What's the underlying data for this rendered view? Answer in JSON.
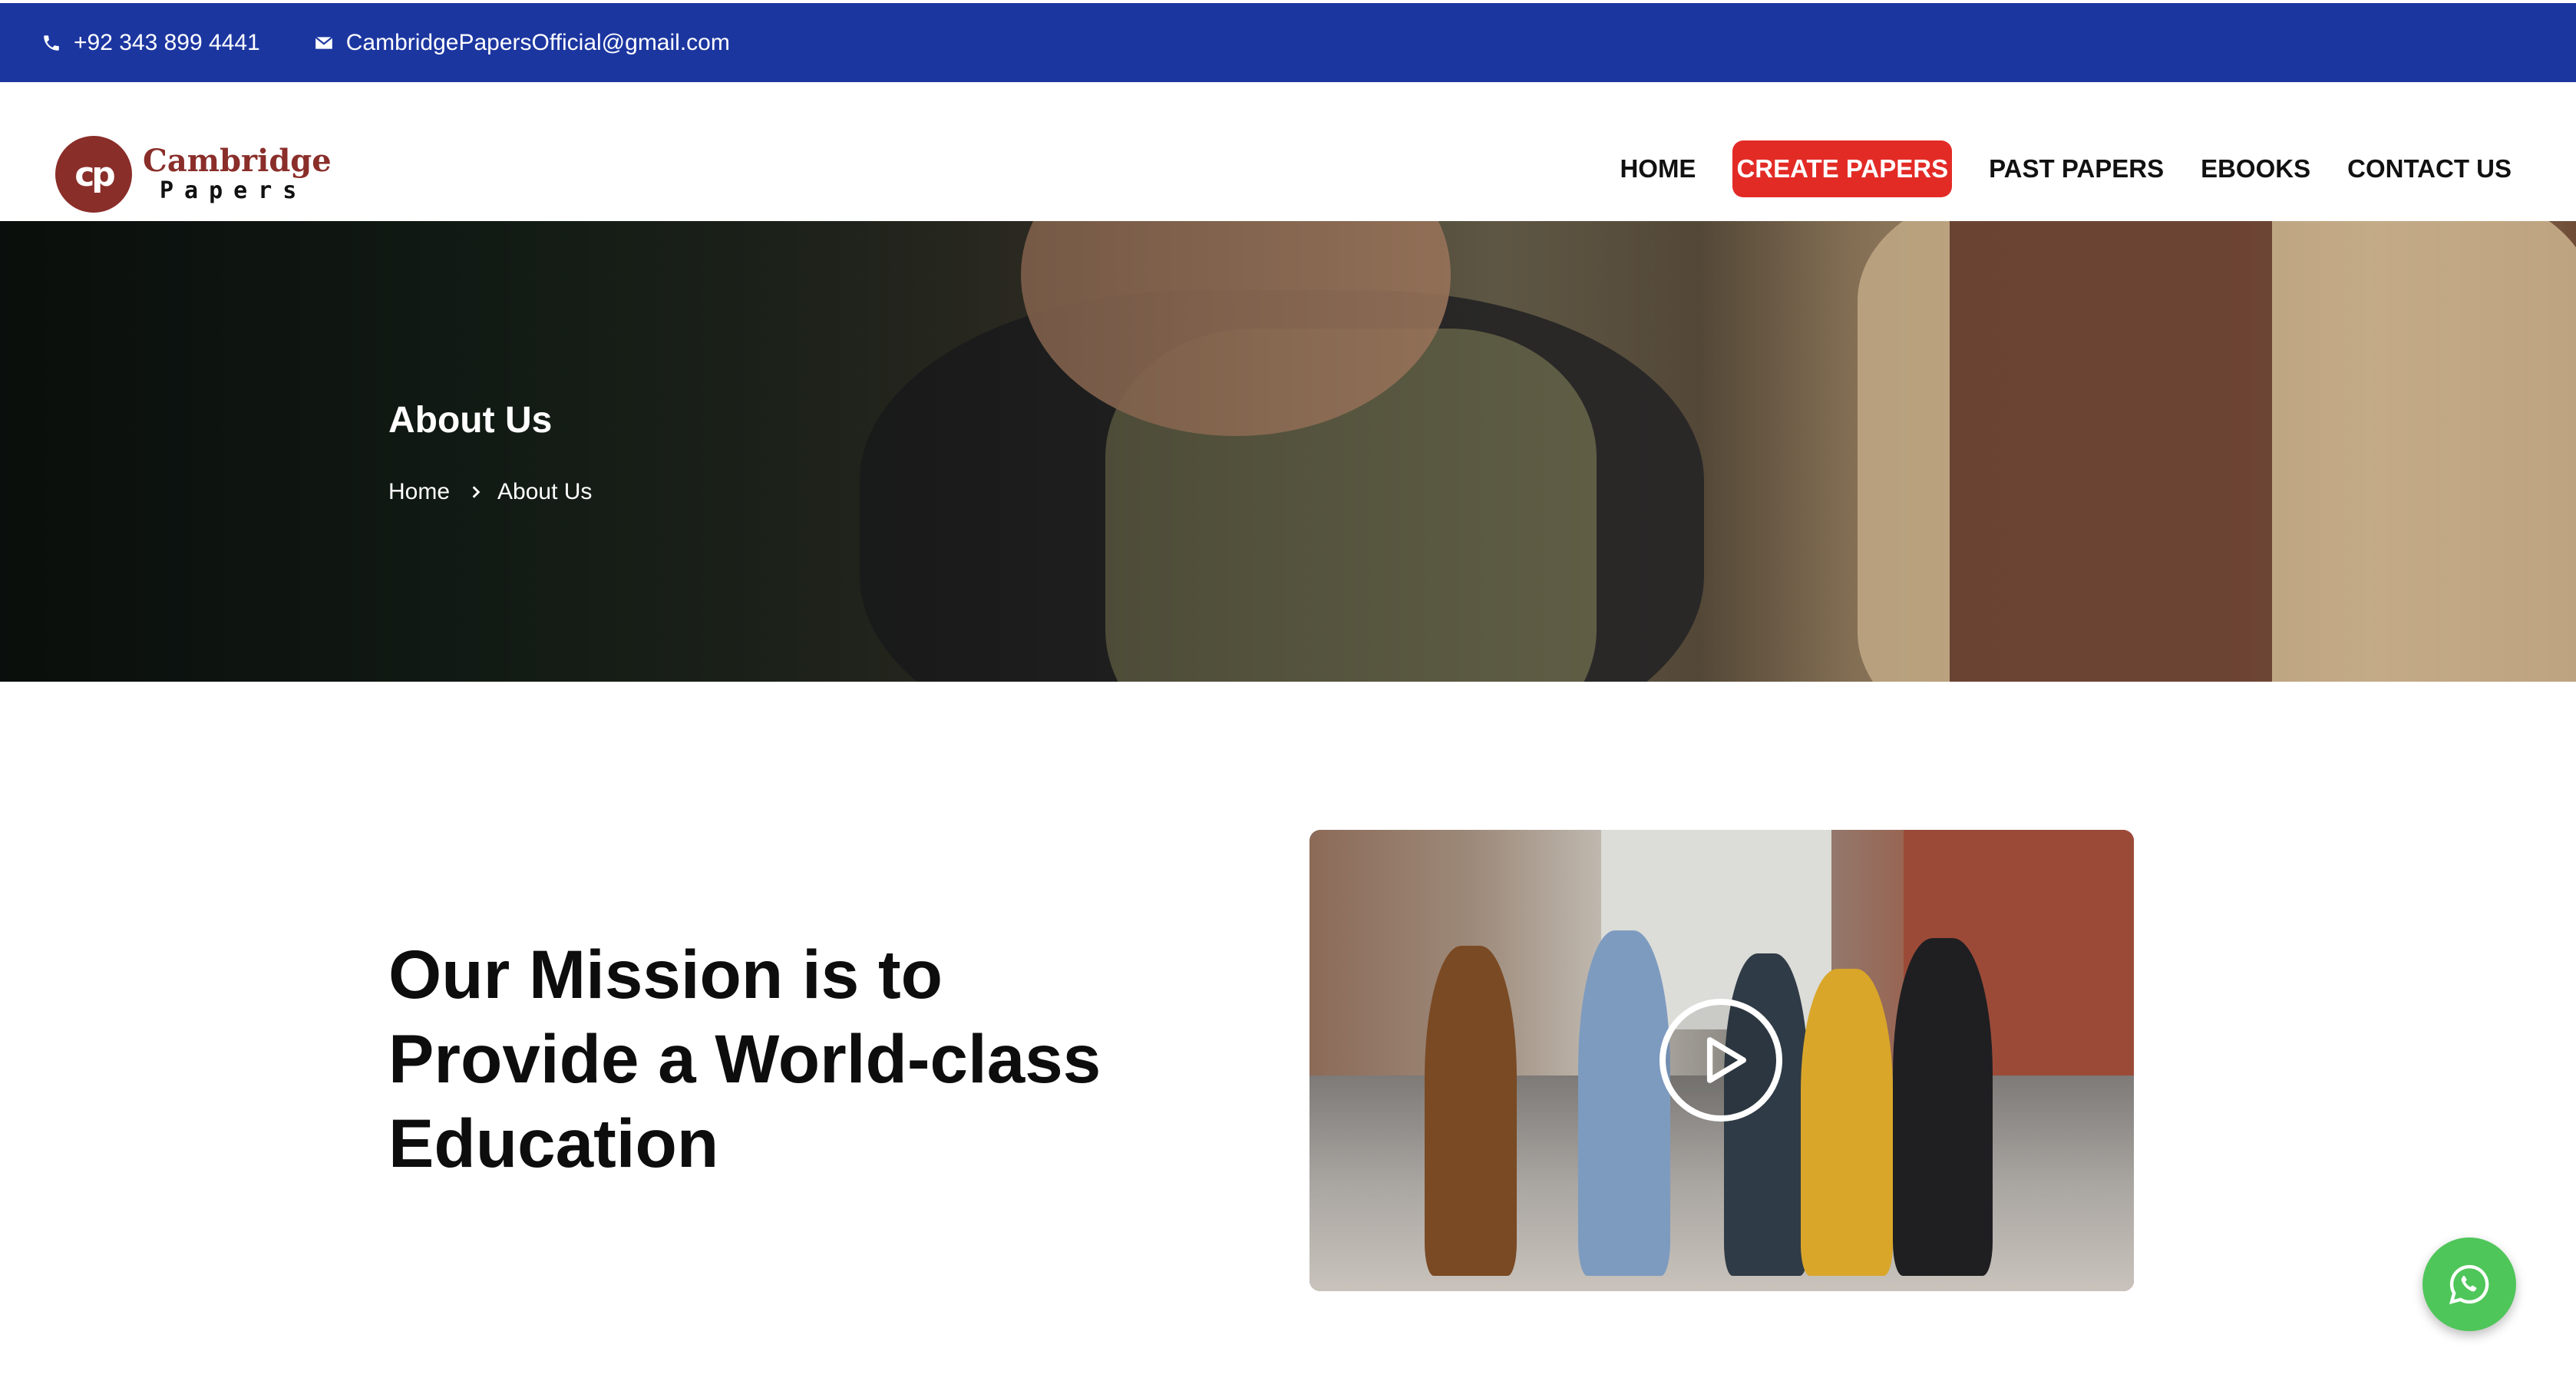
{
  "topbar": {
    "phone": "+92 343 899 4441",
    "email": "CambridgePapersOfficial@gmail.com",
    "phone_icon": "phone-icon",
    "email_icon": "envelope-icon"
  },
  "logo": {
    "mark": "cp",
    "name": "Cambridge",
    "sub": "Papers"
  },
  "nav": {
    "items": [
      {
        "label": "HOME"
      },
      {
        "label": "CREATE PAPERS",
        "highlight": true
      },
      {
        "label": "PAST PAPERS"
      },
      {
        "label": "EBOOKS"
      },
      {
        "label": "CONTACT US"
      }
    ]
  },
  "hero": {
    "title": "About Us",
    "breadcrumb": [
      "Home",
      "About Us"
    ]
  },
  "mission": {
    "heading": "Our Mission is to Provide a World-class Education"
  },
  "video": {
    "play_icon": "play-icon"
  },
  "floating": {
    "whatsapp_icon": "whatsapp-icon"
  },
  "colors": {
    "topbar": "#1c36a0",
    "brand": "#8a2e2a",
    "cta": "#e32b26",
    "whatsapp": "#4fc65a"
  }
}
